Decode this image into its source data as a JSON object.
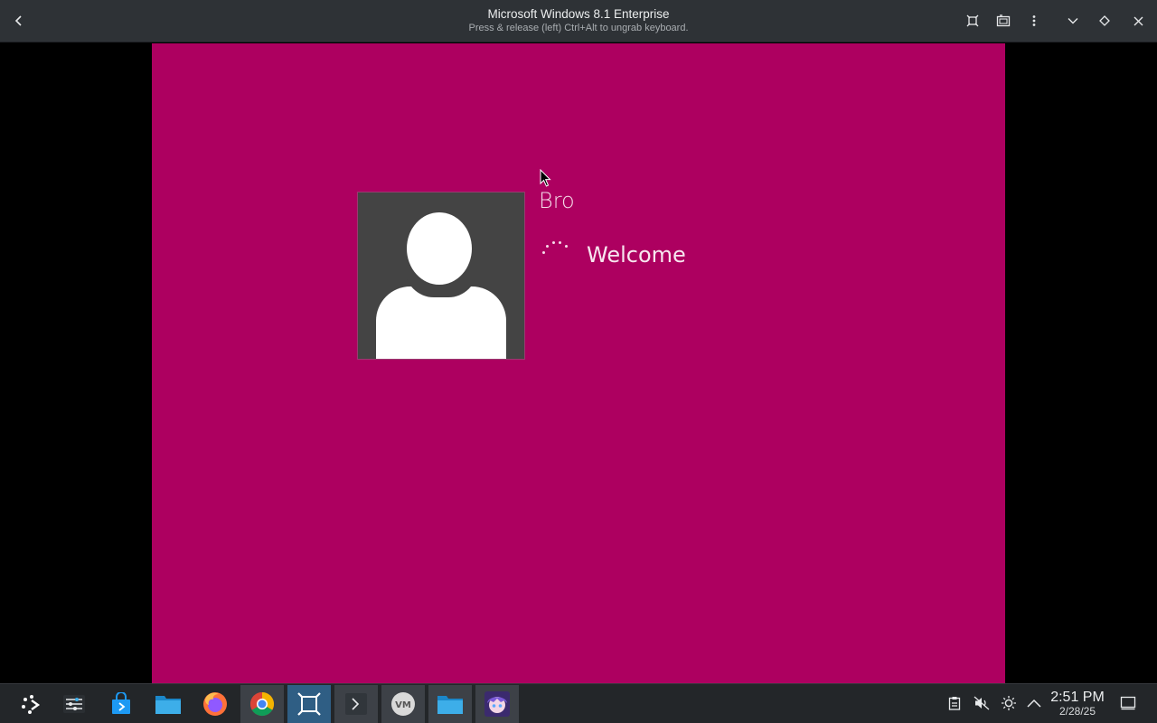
{
  "window": {
    "title": "Microsoft Windows 8.1 Enterprise",
    "subtitle": "Press & release (left) Ctrl+Alt to ungrab keyboard.",
    "buttons": [
      "back-icon",
      "fit-screen-icon",
      "screenshot-icon",
      "menu-icon",
      "minimize-icon",
      "float-icon",
      "close-icon"
    ]
  },
  "guest": {
    "background_color": "#ad0060",
    "user_name": "Bro",
    "status_text": "Welcome"
  },
  "taskbar": {
    "apps": [
      {
        "name": "app-launcher",
        "icon": "launcher-icon"
      },
      {
        "name": "system-settings",
        "icon": "sliders-icon"
      },
      {
        "name": "discover-store",
        "icon": "store-bag-icon"
      },
      {
        "name": "file-manager",
        "icon": "folder-icon"
      },
      {
        "name": "firefox",
        "icon": "firefox-icon"
      },
      {
        "name": "chrome",
        "icon": "chrome-icon"
      },
      {
        "name": "vm-viewer",
        "icon": "vm-viewer-icon"
      },
      {
        "name": "terminal",
        "icon": "terminal-icon"
      },
      {
        "name": "virt-manager",
        "icon": "vm-icon"
      },
      {
        "name": "file-manager-2",
        "icon": "folder-icon"
      },
      {
        "name": "anime-app",
        "icon": "anime-avatar-icon"
      }
    ],
    "tray": [
      "clipboard-icon",
      "volume-muted-icon",
      "brightness-icon",
      "chevron-up-icon"
    ],
    "clock": {
      "time": "2:51 PM",
      "date": "2/28/25"
    },
    "show_desktop_icon": "desktop-icon"
  }
}
